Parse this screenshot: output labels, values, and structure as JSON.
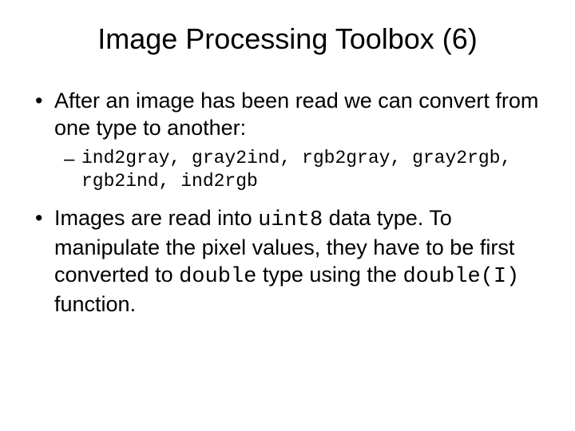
{
  "title": "Image Processing Toolbox (6)",
  "bullets": {
    "b1": "After an image has been read we can convert from one type to another:",
    "b1_sub": "ind2gray, gray2ind, rgb2gray, gray2rgb, rgb2ind, ind2rgb",
    "b2_part1": "Images are read into ",
    "b2_code1": "uint8",
    "b2_part2": " data type. To manipulate the pixel values, they have to be first converted to ",
    "b2_code2": "double",
    "b2_part3": " type using the ",
    "b2_code3": "double(I)",
    "b2_part4": " function."
  }
}
